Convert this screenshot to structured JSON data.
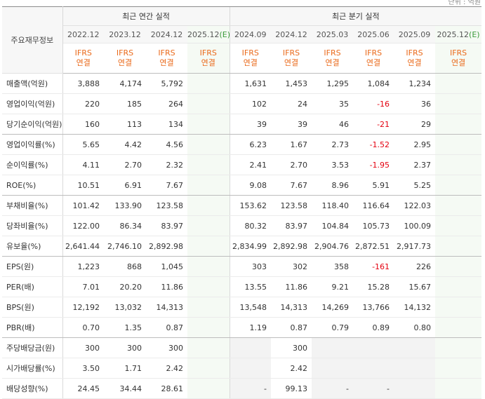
{
  "unit_note": "단위 : 억원",
  "row_header": "주요재무정보",
  "groups": {
    "annual": "최근 연간 실적",
    "quarterly": "최근 분기 실적"
  },
  "periods": [
    "2022.12",
    "2023.12",
    "2024.12",
    "2025.12",
    "2024.09",
    "2024.12",
    "2025.03",
    "2025.06",
    "2025.09",
    "2025.12"
  ],
  "estimate_mark": "(E)",
  "ifrs": {
    "line1": "IFRS",
    "line2": "연결"
  },
  "rows": [
    {
      "label": "매출액(억원)",
      "values": [
        "3,888",
        "4,174",
        "5,792",
        "",
        "1,631",
        "1,453",
        "1,295",
        "1,084",
        "1,234",
        ""
      ]
    },
    {
      "label": "영업이익(억원)",
      "values": [
        "220",
        "185",
        "264",
        "",
        "102",
        "24",
        "35",
        "-16",
        "36",
        ""
      ]
    },
    {
      "label": "당기순이익(억원)",
      "values": [
        "160",
        "113",
        "134",
        "",
        "39",
        "39",
        "46",
        "-21",
        "29",
        ""
      ]
    },
    {
      "label": "영업이익률(%)",
      "values": [
        "5.65",
        "4.42",
        "4.56",
        "",
        "6.23",
        "1.67",
        "2.73",
        "-1.52",
        "2.95",
        ""
      ]
    },
    {
      "label": "순이익률(%)",
      "values": [
        "4.11",
        "2.70",
        "2.32",
        "",
        "2.41",
        "2.70",
        "3.53",
        "-1.95",
        "2.37",
        ""
      ]
    },
    {
      "label": "ROE(%)",
      "values": [
        "10.51",
        "6.91",
        "7.67",
        "",
        "9.08",
        "7.67",
        "8.96",
        "5.91",
        "5.25",
        ""
      ]
    },
    {
      "label": "부채비율(%)",
      "values": [
        "101.42",
        "133.90",
        "123.58",
        "",
        "153.62",
        "123.58",
        "118.40",
        "116.64",
        "122.03",
        ""
      ]
    },
    {
      "label": "당좌비율(%)",
      "values": [
        "122.00",
        "86.34",
        "83.97",
        "",
        "80.32",
        "83.97",
        "104.84",
        "105.73",
        "100.09",
        ""
      ]
    },
    {
      "label": "유보율(%)",
      "values": [
        "2,641.44",
        "2,746.10",
        "2,892.98",
        "",
        "2,834.99",
        "2,892.98",
        "2,904.76",
        "2,872.51",
        "2,917.73",
        ""
      ]
    },
    {
      "label": "EPS(원)",
      "values": [
        "1,223",
        "868",
        "1,045",
        "",
        "303",
        "302",
        "358",
        "-161",
        "226",
        ""
      ]
    },
    {
      "label": "PER(배)",
      "values": [
        "7.01",
        "20.20",
        "11.86",
        "",
        "13.55",
        "11.86",
        "9.21",
        "15.28",
        "15.67",
        ""
      ]
    },
    {
      "label": "BPS(원)",
      "values": [
        "12,192",
        "13,032",
        "14,313",
        "",
        "13,548",
        "14,313",
        "14,269",
        "13,766",
        "14,132",
        ""
      ]
    },
    {
      "label": "PBR(배)",
      "values": [
        "0.70",
        "1.35",
        "0.87",
        "",
        "1.19",
        "0.87",
        "0.79",
        "0.89",
        "0.80",
        ""
      ]
    },
    {
      "label": "주당배당금(원)",
      "values": [
        "300",
        "300",
        "300",
        "",
        "",
        "300",
        "",
        "",
        "",
        ""
      ]
    },
    {
      "label": "시가배당률(%)",
      "values": [
        "3.50",
        "1.71",
        "2.42",
        "",
        "",
        "2.42",
        "",
        "",
        "",
        ""
      ]
    },
    {
      "label": "배당성향(%)",
      "values": [
        "24.45",
        "34.44",
        "28.61",
        "",
        "-",
        "99.13",
        "-",
        "-",
        "",
        ""
      ]
    }
  ],
  "colors": {
    "negative": "#e4000f",
    "ifrs": "#ea6a1b",
    "estimate": "#3a9a3a"
  }
}
